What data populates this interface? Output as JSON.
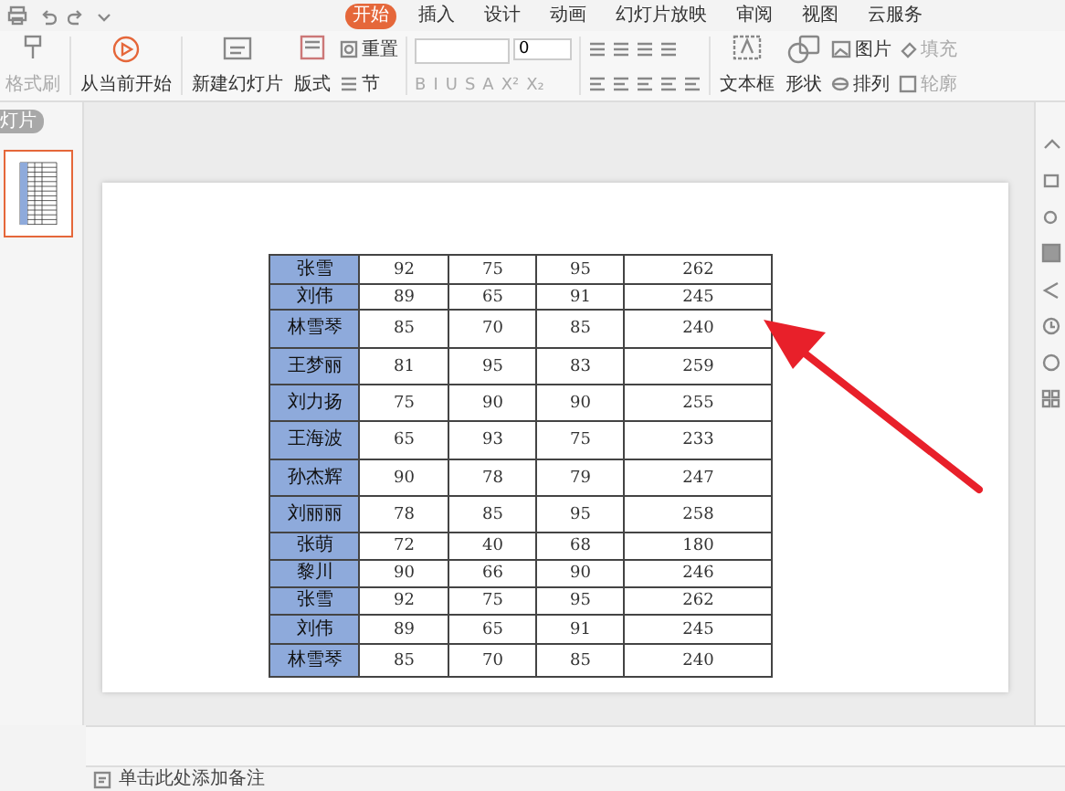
{
  "tabs": [
    {
      "label": "开始",
      "selected": true
    },
    {
      "label": "插入",
      "selected": false
    },
    {
      "label": "设计",
      "selected": false
    },
    {
      "label": "动画",
      "selected": false
    },
    {
      "label": "幻灯片放映",
      "selected": false
    },
    {
      "label": "审阅",
      "selected": false
    },
    {
      "label": "视图",
      "selected": false
    },
    {
      "label": "云服务",
      "selected": false
    }
  ],
  "ribbon": {
    "format_painter": {
      "label": "格式刷",
      "disabled": true
    },
    "play_from_current": {
      "label": "从当前开始"
    },
    "new_slide": {
      "label": "新建幻灯片"
    },
    "layout": {
      "label": "版式"
    },
    "reset": {
      "label": "重置"
    },
    "section": {
      "label": "节"
    },
    "font_size": "0",
    "format_buttons": [
      "B",
      "I",
      "U",
      "S",
      "A",
      "X²",
      "X₂"
    ],
    "text_box": {
      "label": "文本框"
    },
    "shape": {
      "label": "形状"
    },
    "picture": {
      "label": "图片"
    },
    "arrange": {
      "label": "排列"
    },
    "fill": {
      "label": "填充"
    },
    "outline": {
      "label": "轮廓"
    }
  },
  "left_panel": {
    "tab": "灯片",
    "thumbnails": [
      {
        "selected": true
      }
    ]
  },
  "table": {
    "rows": [
      {
        "name": "张雪",
        "values": [
          "92",
          "75",
          "95",
          "262"
        ]
      },
      {
        "name": "刘伟",
        "values": [
          "89",
          "65",
          "91",
          "245"
        ]
      },
      {
        "name": "林雪琴",
        "values": [
          "85",
          "70",
          "85",
          "240"
        ]
      },
      {
        "name": "王梦丽",
        "values": [
          "81",
          "95",
          "83",
          "259"
        ]
      },
      {
        "name": "刘力扬",
        "values": [
          "75",
          "90",
          "90",
          "255"
        ]
      },
      {
        "name": "王海波",
        "values": [
          "65",
          "93",
          "75",
          "233"
        ]
      },
      {
        "name": "孙杰辉",
        "values": [
          "90",
          "78",
          "79",
          "247"
        ]
      },
      {
        "name": "刘丽丽",
        "values": [
          "78",
          "85",
          "95",
          "258"
        ]
      },
      {
        "name": "张萌",
        "values": [
          "72",
          "40",
          "68",
          "180"
        ]
      },
      {
        "name": "黎川",
        "values": [
          "90",
          "66",
          "90",
          "246"
        ]
      },
      {
        "name": "张雪",
        "values": [
          "92",
          "75",
          "95",
          "262"
        ]
      },
      {
        "name": "刘伟",
        "values": [
          "89",
          "65",
          "91",
          "245"
        ]
      },
      {
        "name": "林雪琴",
        "values": [
          "85",
          "70",
          "85",
          "240"
        ]
      }
    ]
  },
  "notes": {
    "placeholder": "单击此处添加备注"
  }
}
